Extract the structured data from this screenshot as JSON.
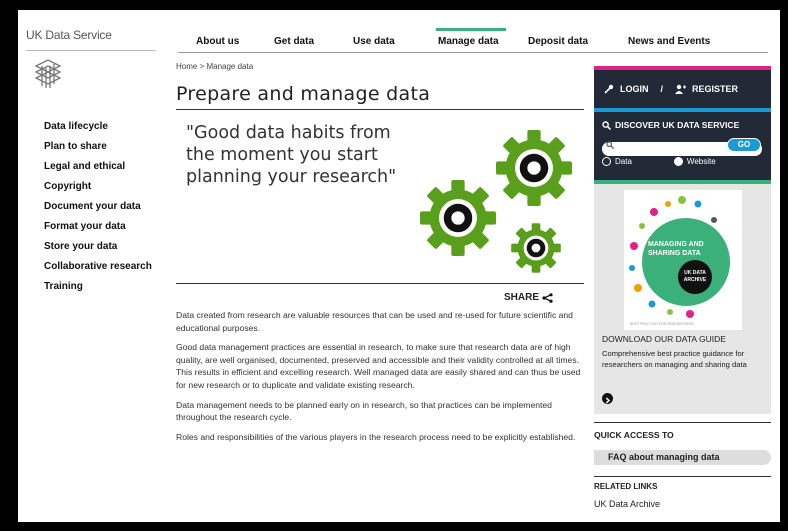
{
  "header": {
    "logo_text": "UK Data Service",
    "nav": [
      {
        "label": "About us"
      },
      {
        "label": "Get data"
      },
      {
        "label": "Use data"
      },
      {
        "label": "Manage data",
        "active": true
      },
      {
        "label": "Deposit data"
      },
      {
        "label": "News and Events"
      }
    ]
  },
  "breadcrumb": "Home > Manage data",
  "page_title": "Prepare and manage data",
  "sidebar": {
    "items": [
      {
        "label": "Data lifecycle"
      },
      {
        "label": "Plan to share"
      },
      {
        "label": "Legal and ethical"
      },
      {
        "label": "Copyright"
      },
      {
        "label": "Document your data"
      },
      {
        "label": "Format your data"
      },
      {
        "label": "Store your data"
      },
      {
        "label": "Collaborative research"
      },
      {
        "label": "Training"
      }
    ]
  },
  "hero": {
    "quote": "\"Good data habits from the moment you start planning your research\""
  },
  "share_label": "SHARE",
  "body": {
    "paragraphs": [
      "Data created from research are valuable resources that can be used and re-used for future scientific and educational purposes.",
      "Good data management practices are essential in research, to make sure that research data are of high quality, are well organised, documented, preserved and accessible and their validity controlled at all times. This results in efficient and excelling research. Well managed data are easily shared and can thus be used for new research or to duplicate and validate existing research.",
      "Data management needs to be planned early on in research, so that practices can be implemented throughout the research cycle.",
      "Roles and responsibilities of the various players in the research process need to be explicitly established."
    ]
  },
  "account": {
    "login_label": "LOGIN",
    "separator": "/",
    "register_label": "REGISTER"
  },
  "discover": {
    "heading": "DISCOVER UK DATA SERVICE",
    "search_placeholder": "",
    "go_label": "GO",
    "radio_data": "Data",
    "radio_website": "Website",
    "selected": "Website"
  },
  "guide": {
    "cover_title": "MANAGING AND SHARING DATA",
    "cover_badge": "UK DATA ARCHIVE",
    "cover_footer": "BEST PRACTICE FOR RESEARCHERS",
    "heading": "DOWNLOAD OUR DATA GUIDE",
    "description": "Comprehensive best practice guidance for researchers on managing and sharing data"
  },
  "quick_access": {
    "title": "QUICK ACCESS TO",
    "faq_label": "FAQ about managing data"
  },
  "related": {
    "title": "RELATED LINKS",
    "link": "UK Data Archive"
  },
  "colors": {
    "accent_green": "#3bb07a",
    "gear_green": "#5a9f1c",
    "magenta": "#e0218a",
    "blue": "#1b9ad6",
    "dark_panel": "#222a38"
  }
}
